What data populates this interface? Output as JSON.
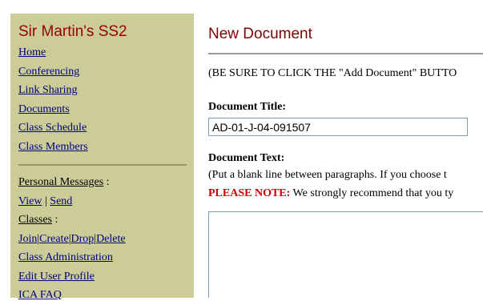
{
  "sidebar": {
    "site_title": "Sir Martin's SS2",
    "nav": [
      {
        "label": "Home"
      },
      {
        "label": "Conferencing"
      },
      {
        "label": "Link Sharing"
      },
      {
        "label": "Documents"
      },
      {
        "label": "Class Schedule"
      },
      {
        "label": "Class Members"
      }
    ],
    "personal_messages": {
      "label": "Personal Messages",
      "suffix": " :",
      "view": "View",
      "sep": "|",
      "send": "Send"
    },
    "classes": {
      "label": "Classes",
      "suffix": " :",
      "join": "Join",
      "create": "Create",
      "drop": "Drop",
      "delete": "Delete",
      "sep": "|"
    },
    "bottom_nav": [
      {
        "label": "Class Administration"
      },
      {
        "label": "Edit User Profile"
      },
      {
        "label": "ICA FAQ"
      }
    ]
  },
  "main": {
    "title": "New Document",
    "note": "(BE SURE TO CLICK THE \"Add Document\" BUTTO",
    "doc_title_label": "Document Title:",
    "doc_title_value": "AD-01-J-04-091507",
    "doc_text_label": "Document Text:",
    "hint": "(Put a blank line between paragraphs. If you choose t",
    "please_label": "PLEASE NOTE:",
    "please_text": " We strongly recommend that you ty",
    "doc_text_value": ""
  }
}
